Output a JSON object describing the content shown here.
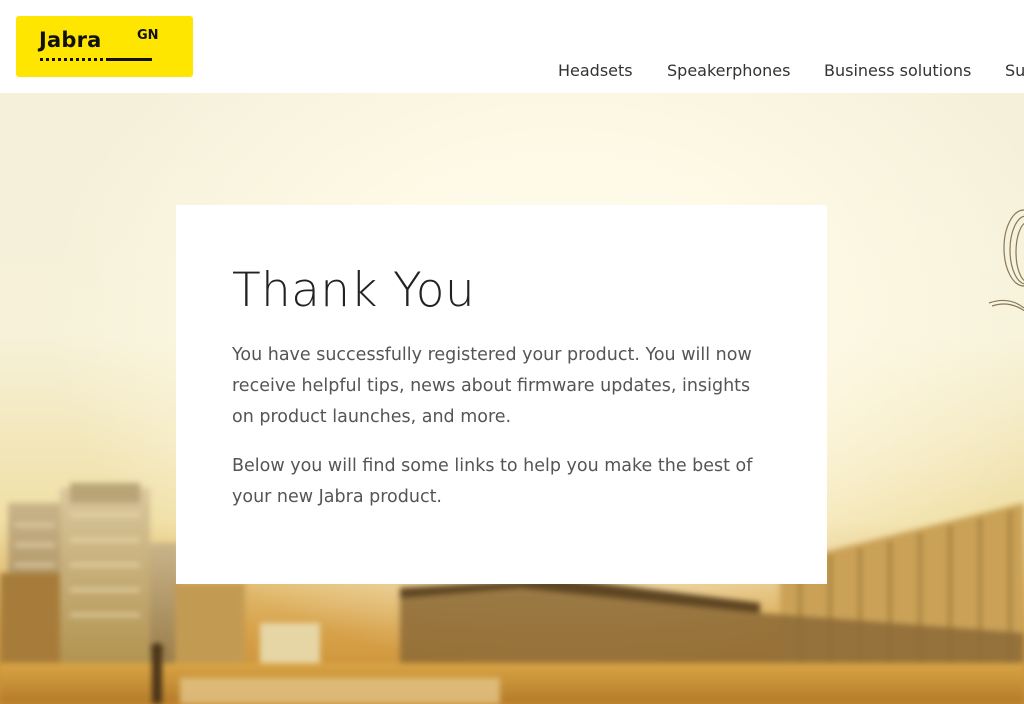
{
  "logo": {
    "word": "Jabra",
    "suffix": "GN"
  },
  "nav": {
    "items": [
      {
        "label": "Headsets"
      },
      {
        "label": "Speakerphones"
      },
      {
        "label": "Business solutions"
      },
      {
        "label": "Su"
      }
    ]
  },
  "card": {
    "title": "Thank You",
    "paragraph1": "You have successfully registered your product. You will now receive helpful tips, news about firmware updates, insights on product launches, and more.",
    "paragraph2": "Below you will find some links to help you make the best of your new Jabra product."
  },
  "colors": {
    "brand_yellow": "#ffe600",
    "text_dark": "#222222",
    "text_body": "#555555"
  }
}
